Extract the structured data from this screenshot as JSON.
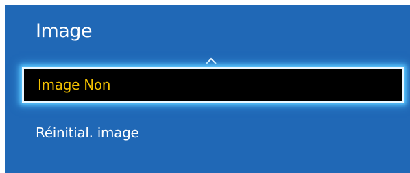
{
  "menu": {
    "title": "Image",
    "scroll_up_icon": "chevron-up-icon",
    "items": [
      {
        "label": "Image Non",
        "selected": true
      },
      {
        "label": "Réinitial. image",
        "selected": false
      }
    ]
  },
  "colors": {
    "panel_background": "#2068b6",
    "selected_background": "#000000",
    "selected_text": "#f4c200",
    "focus_glow": "#5cc8ff",
    "text": "#ffffff"
  }
}
